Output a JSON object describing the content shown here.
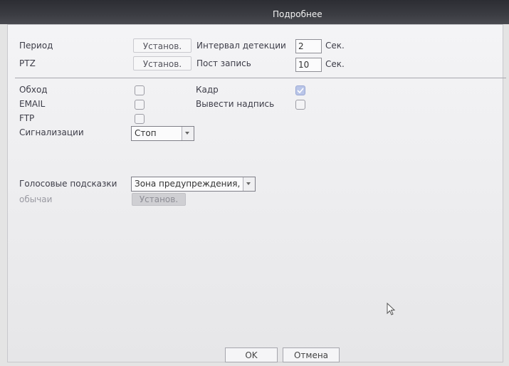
{
  "window": {
    "title": "Подробнее"
  },
  "rows": {
    "period": {
      "label": "Период",
      "button": "Установ."
    },
    "ptz": {
      "label": "PTZ",
      "button": "Установ."
    },
    "detect_interval": {
      "label": "Интервал детекции",
      "value": "2",
      "unit": "Сек."
    },
    "post_record": {
      "label": "Пост запись",
      "value": "10",
      "unit": "Сек."
    },
    "tour": {
      "label": "Обход",
      "checked": false
    },
    "email": {
      "label": "EMAIL",
      "checked": false
    },
    "ftp": {
      "label": "FTP",
      "checked": false
    },
    "frame": {
      "label": "Кадр",
      "checked": true
    },
    "overlay": {
      "label": "Вывести надпись",
      "checked": false
    },
    "alarm": {
      "label": "Сигнализации",
      "selected": "Стоп"
    },
    "voice": {
      "label": "Голосовые подсказки",
      "selected": "Зона предупреждения,"
    },
    "custom": {
      "label": "обычаи",
      "button": "Установ."
    }
  },
  "footer": {
    "ok": "OK",
    "cancel": "Отмена"
  },
  "colors": {
    "titlebar": "#3b3c42",
    "panel": "#f0f0f2",
    "checked": "#b9c5e8"
  }
}
